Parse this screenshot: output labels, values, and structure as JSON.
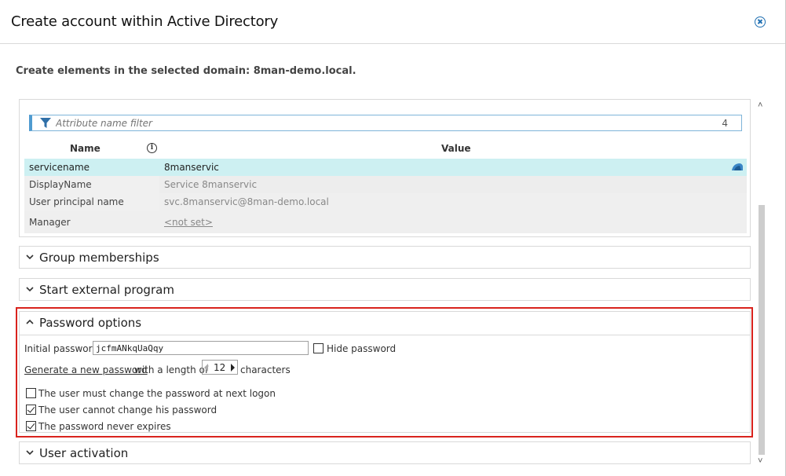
{
  "dialog": {
    "title": "Create account within Active Directory",
    "subtitle": "Create elements in the selected domain: 8man-demo.local."
  },
  "attributes": {
    "filter_placeholder": "Attribute name filter",
    "filter_count": "4",
    "col_name": "Name",
    "col_value": "Value",
    "rows": [
      {
        "name": "servicename",
        "value": "8manservic"
      },
      {
        "name": "DisplayName",
        "value": "Service 8manservic"
      },
      {
        "name": "User principal name",
        "value": "svc.8manservic@8man-demo.local"
      },
      {
        "name": "Manager",
        "value": "<not set>"
      }
    ]
  },
  "sections": {
    "group_memberships": "Group memberships",
    "start_external_program": "Start external program",
    "password_options": "Password options",
    "user_activation": "User activation"
  },
  "password": {
    "initial_label": "Initial password",
    "initial_value": "jcfmANkqUaQqy",
    "hide_label": "Hide password",
    "hide_checked": false,
    "generate_link": "Generate a new password",
    "length_prefix": "with a length of",
    "length_value": "12",
    "length_suffix": "characters",
    "options": [
      {
        "label": "The user must change the password at next logon",
        "checked": false
      },
      {
        "label": "The user cannot change his password",
        "checked": true
      },
      {
        "label": "The password never expires",
        "checked": true
      }
    ]
  },
  "colors": {
    "selected_row": "#cdf0f2",
    "highlight_border": "#d9231d",
    "link": "#1f5fa0",
    "filter_accent": "#4f9bd0"
  }
}
